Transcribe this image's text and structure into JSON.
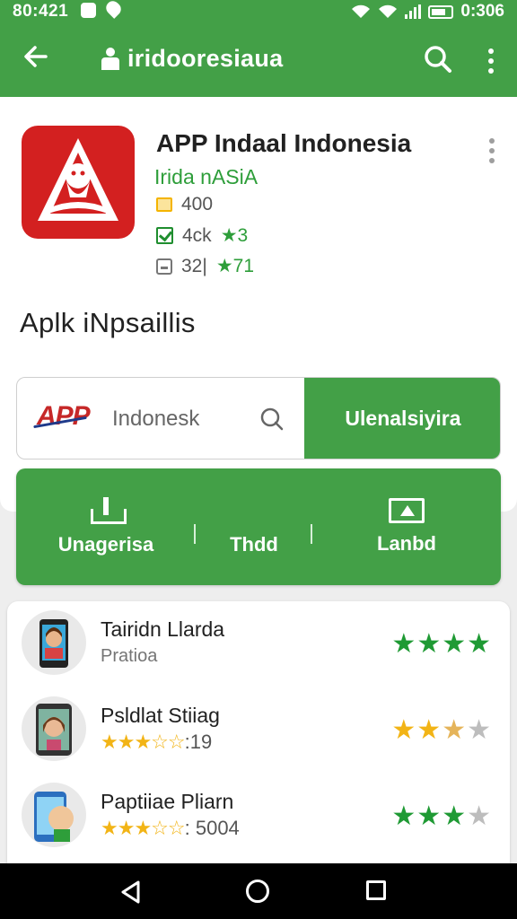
{
  "status_bar": {
    "time": "80:421",
    "right_time": "0:306",
    "icons": [
      "notification-icon",
      "location-icon",
      "wifi-icon",
      "wifi-icon",
      "signal-icon",
      "battery-icon"
    ]
  },
  "app_bar": {
    "title": "iridooresiaua",
    "back_icon": "arrow-left-icon",
    "search_icon": "search-icon",
    "menu_icon": "more-vert-icon"
  },
  "app": {
    "name": "APP Indaal Indonesia",
    "developer": "Irida nASiA",
    "meta": [
      {
        "icon": "badge-icon",
        "text": "400"
      },
      {
        "icon": "check-icon",
        "text": "4ck",
        "rating": "★3"
      },
      {
        "icon": "download-icon",
        "text": "32|",
        "rating": "★71"
      }
    ],
    "icon_name": "app-logo-icon"
  },
  "section_title": "Aplk iNpsaillis",
  "search": {
    "logo_text": "APP",
    "text": "Indonesk",
    "action_label": "Ulenalsiyira"
  },
  "actions": [
    {
      "label": "Unagerisa",
      "icon": "download-icon"
    },
    {
      "label": "Thdd",
      "icon": ""
    },
    {
      "label": "Lanbd",
      "icon": "screen-icon"
    }
  ],
  "list": [
    {
      "title": "Tairidn Llarda",
      "subtitle": "Pratioa",
      "stars": "",
      "count": "",
      "rating": [
        "g",
        "g",
        "g",
        "g"
      ]
    },
    {
      "title": "Psldlat Stiiag",
      "subtitle": "",
      "stars": "★★★☆☆",
      "count": ":19",
      "rating": [
        "y",
        "y",
        "o",
        "e"
      ]
    },
    {
      "title": "Paptiiae Pliarn",
      "subtitle": "",
      "stars": "★★★☆☆",
      "count": ": 5004",
      "rating": [
        "g",
        "g",
        "g",
        "e"
      ]
    }
  ],
  "colors": {
    "primary": "#43a047",
    "logo_red": "#d32020",
    "star_green": "#1f9a34",
    "star_yellow": "#f2b416"
  },
  "nav": {
    "back": "triangle-back-icon",
    "home": "circle-home-icon",
    "recent": "square-recent-icon"
  }
}
